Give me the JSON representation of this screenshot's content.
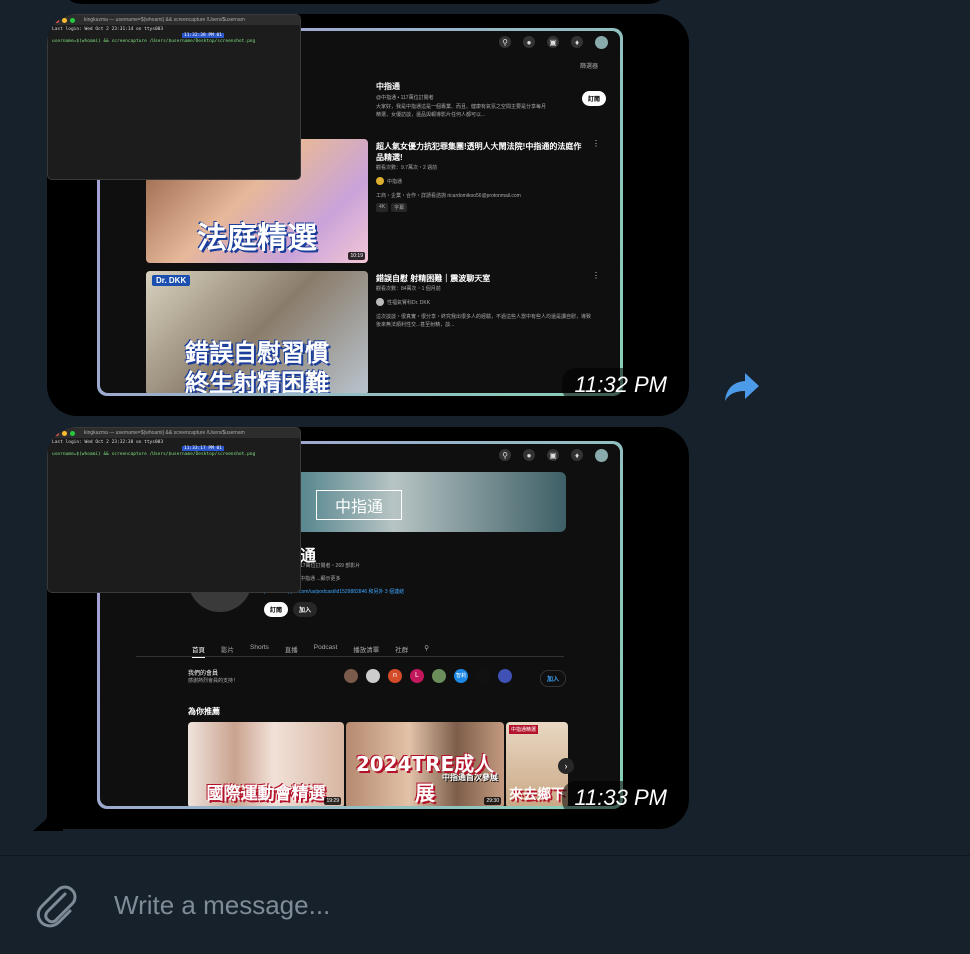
{
  "messages": [
    {
      "time": "11:32 PM",
      "terminal": {
        "title": "kingkazma — username=$(whoami) && screencapture /Users/$usernam",
        "line1": "Last login: Wed Oct  2 23:31:14 on ttys003",
        "status": "11:32:38 PM 01",
        "line2": "username=$(whoami) && screencapture /Users/$username/Desktop/screenshot.png"
      },
      "youtube": {
        "filter_label": "篩選器",
        "channel_name": "中指通",
        "channel_meta": "@中指通 • 117萬位訂閱者",
        "channel_desc1": "大家好，我是中指通這是一個專業、而且、健康有氣氛之空間主要是分享每月",
        "channel_desc2": "精選，女優訪談，還品與報導影片任何人都可以...",
        "subscribe_label": "訂閱",
        "video1": {
          "title1": "超人氣女優力抗犯罪集團!透明人大鬧法院!中指通的法庭作",
          "title2": "品精選!",
          "meta": "觀看次數：9.7萬次・2 週前",
          "channel": "中指通",
          "desc": "工商・企業・合作・詳請看諮詢 ricardomikoo56@protonmail.com",
          "badges": [
            "4K",
            "字幕"
          ],
          "caption": "法庭精選",
          "duration": "10:19"
        },
        "video2": {
          "title": "錯誤自慰 射精困難｜震波聊天室",
          "meta": "觀看次數：84萬次・1 個月前",
          "channel": "性福氣腎科Dr. DKK",
          "desc1": "這次談談・很真實・很分享・終究我出很多人的經驗，不過這些人當中有些人均還是讀自慰，導致",
          "desc2": "後來無法順利性交...甚至射精，談...",
          "tag": "Dr. DKK",
          "caption1": "錯誤自慰習慣",
          "caption2": "終生射精困難"
        }
      }
    },
    {
      "time": "11:33 PM",
      "terminal": {
        "title": "kingkazma — username=$(whoami) && screencapture /Users/$usernam",
        "line1": "Last login: Wed Oct  2 23:32:38 on ttys003",
        "status": "11:33:17 PM 01",
        "line2": "username=$(whoami) && screencapture /Users/$username/Desktop/screenshot.png"
      },
      "youtube": {
        "banner_title": "中指通",
        "channel_name_partial": "通",
        "channel_meta": "17萬位訂閱者・269 部影片",
        "about": "中指通 ...顯示更多",
        "link": "podcasts.apple.com/us/podcast/id1529882846 和另外 3 個連結",
        "subscribe_label": "訂閱",
        "join_label": "加入",
        "tabs": [
          "首頁",
          "影片",
          "Shorts",
          "直播",
          "Podcast",
          "播放清單",
          "社群"
        ],
        "members_title": "我們的會員",
        "members_sub": "感謝熱烈會員的支持！",
        "member_avatars": [
          "",
          "",
          "n",
          "L",
          "",
          "智莉",
          "",
          ""
        ],
        "members_join": "加入",
        "recommend_title": "為你推薦",
        "thumbs": [
          {
            "caption": "國際運動會精選",
            "duration": "19:29"
          },
          {
            "caption": "2024TRE成人展",
            "overlay": "中指通首次參展",
            "duration": "29:30"
          },
          {
            "caption": "來去鄉下",
            "tag": "中指通精選"
          }
        ]
      }
    }
  ],
  "composer": {
    "placeholder": "Write a message..."
  }
}
